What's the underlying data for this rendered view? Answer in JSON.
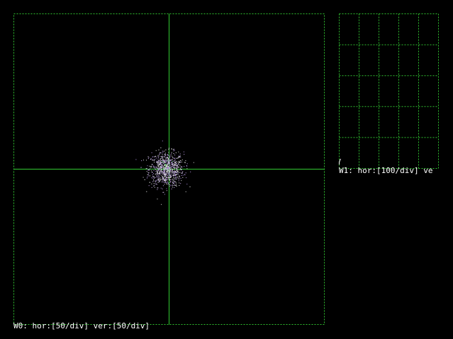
{
  "theme": {
    "background": "#000000",
    "grid_color": "#2fbf2f",
    "axis_color": "#33cc33",
    "text_color": "#ffffff",
    "trace_color": "#ffffff",
    "point_colors": [
      "#ffffff",
      "#c8a8f0",
      "#d8d8d8",
      "#b090e0"
    ]
  },
  "windows": {
    "w0": {
      "label": "W0: hor:[50/div] ver:[50/div]",
      "hor_per_div": 50,
      "ver_per_div": 50,
      "axes": "crosshair"
    },
    "w1": {
      "label": "W1: hor:[100/div] ve",
      "hor_per_div": 100,
      "columns": 5,
      "rows": 5
    }
  },
  "chart_data": [
    {
      "type": "scatter",
      "window": "W0",
      "title": "",
      "xlabel": "",
      "ylabel": "",
      "hor_per_div": 50,
      "ver_per_div": 50,
      "cluster_center": [
        -5,
        0
      ],
      "cluster_spread": 14,
      "grid": false,
      "description_units": "data units"
    },
    {
      "type": "line",
      "window": "W1",
      "title": "",
      "hor_per_div": 100,
      "grid": true,
      "columns": 5,
      "rows": 5
    }
  ]
}
